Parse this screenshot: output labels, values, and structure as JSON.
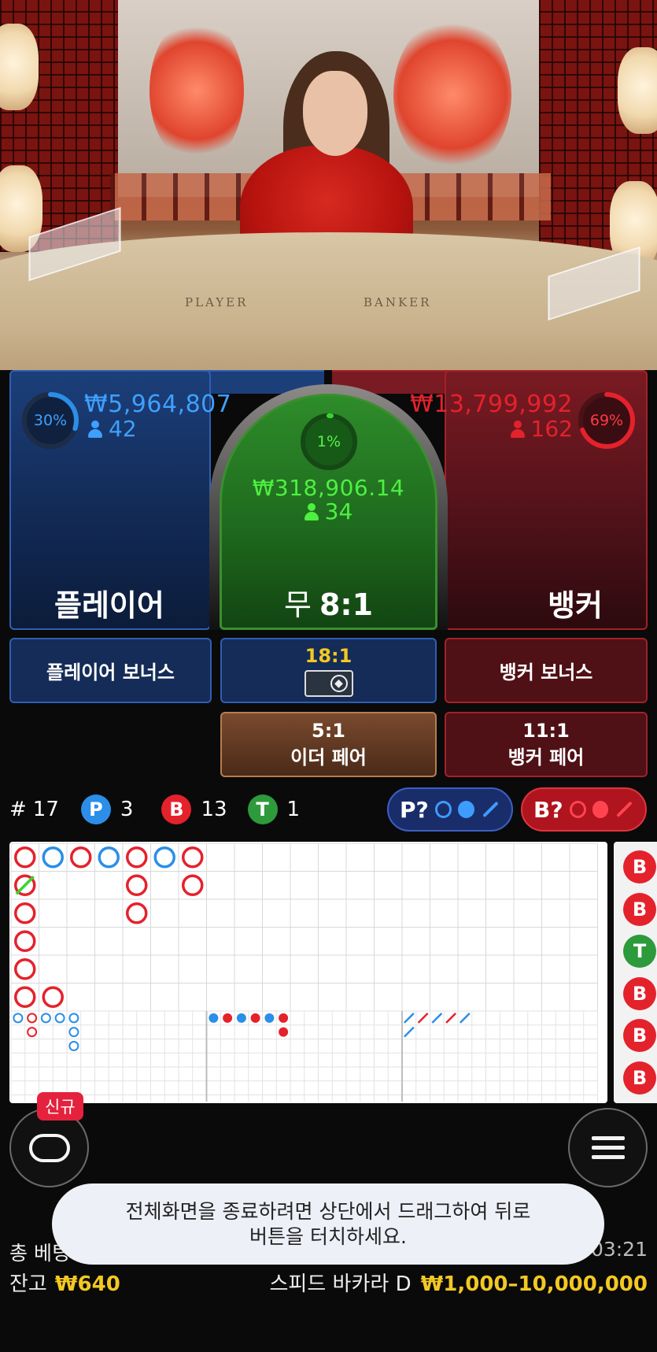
{
  "video": {
    "table_left_text": "PLAYER",
    "table_right_text": "BANKER"
  },
  "colors": {
    "player_blue": "#2b8ee8",
    "banker_red": "#e4222c",
    "tie_green": "#37d52f",
    "gold": "#f3c823"
  },
  "player": {
    "percent": "30%",
    "percent_value": 0.3,
    "amount": "₩5,964,807",
    "players": "42",
    "label": "플레이어"
  },
  "tie": {
    "percent": "1%",
    "percent_value": 0.01,
    "amount": "₩318,906.14",
    "players": "34",
    "label_main": "무",
    "label_odds": "8:1"
  },
  "banker": {
    "percent": "69%",
    "percent_value": 0.69,
    "amount": "₩13,799,992",
    "players": "162",
    "label": "뱅커"
  },
  "side_bets": {
    "player_bonus": "플레이어 보너스",
    "dragon_odds": "18:1",
    "banker_bonus": "뱅커 보너스",
    "either_pair_odds": "5:1",
    "either_pair_label": "이더 페어",
    "banker_pair_odds": "11:1",
    "banker_pair_label": "뱅커 페어"
  },
  "stats": {
    "round_prefix": "#",
    "round": "17",
    "p_letter": "P",
    "p_count": "3",
    "b_letter": "B",
    "b_count": "13",
    "t_letter": "T",
    "t_count": "1"
  },
  "predict": {
    "player": "P?",
    "banker": "B?"
  },
  "scoreboard": {
    "big_road": [
      {
        "col": 0,
        "row": 0,
        "r": "B"
      },
      {
        "col": 0,
        "row": 1,
        "r": "B",
        "tie": true
      },
      {
        "col": 0,
        "row": 2,
        "r": "B"
      },
      {
        "col": 0,
        "row": 3,
        "r": "B"
      },
      {
        "col": 0,
        "row": 4,
        "r": "B"
      },
      {
        "col": 0,
        "row": 5,
        "r": "B"
      },
      {
        "col": 1,
        "row": 0,
        "r": "P"
      },
      {
        "col": 1,
        "row": 5,
        "r": "B"
      },
      {
        "col": 2,
        "row": 0,
        "r": "B"
      },
      {
        "col": 3,
        "row": 0,
        "r": "P"
      },
      {
        "col": 4,
        "row": 0,
        "r": "B"
      },
      {
        "col": 4,
        "row": 1,
        "r": "B"
      },
      {
        "col": 4,
        "row": 2,
        "r": "B"
      },
      {
        "col": 5,
        "row": 0,
        "r": "P"
      },
      {
        "col": 6,
        "row": 0,
        "r": "B"
      },
      {
        "col": 6,
        "row": 1,
        "r": "B"
      }
    ],
    "big_eye": [
      {
        "col": 0,
        "row": 0,
        "c": "P"
      },
      {
        "col": 1,
        "row": 0,
        "c": "B"
      },
      {
        "col": 1,
        "row": 1,
        "c": "B"
      },
      {
        "col": 2,
        "row": 0,
        "c": "P"
      },
      {
        "col": 3,
        "row": 0,
        "c": "P"
      },
      {
        "col": 4,
        "row": 0,
        "c": "P"
      },
      {
        "col": 4,
        "row": 1,
        "c": "P"
      },
      {
        "col": 4,
        "row": 2,
        "c": "P"
      }
    ],
    "small_road": [
      {
        "col": 0,
        "row": 0,
        "c": "P"
      },
      {
        "col": 1,
        "row": 0,
        "c": "B"
      },
      {
        "col": 2,
        "row": 0,
        "c": "P"
      },
      {
        "col": 3,
        "row": 0,
        "c": "B"
      },
      {
        "col": 4,
        "row": 0,
        "c": "P"
      },
      {
        "col": 5,
        "row": 0,
        "c": "B"
      },
      {
        "col": 5,
        "row": 1,
        "c": "B"
      }
    ],
    "cockroach": [
      {
        "col": 0,
        "row": 0,
        "c": "P"
      },
      {
        "col": 0,
        "row": 1,
        "c": "P"
      },
      {
        "col": 1,
        "row": 0,
        "c": "B"
      },
      {
        "col": 2,
        "row": 0,
        "c": "P"
      },
      {
        "col": 3,
        "row": 0,
        "c": "B"
      },
      {
        "col": 4,
        "row": 0,
        "c": "P"
      }
    ],
    "side_column": [
      "B",
      "B",
      "T",
      "B",
      "B",
      "B"
    ]
  },
  "controls": {
    "new_badge": "신규"
  },
  "toast": {
    "line1": "전체화면을 종료하려면 상단에서 드래그하여 뒤로",
    "line2": "버튼을 터치하세요."
  },
  "footer": {
    "total_bet_label": "총 베팅",
    "time": "/:03:21",
    "balance_label": "잔고",
    "balance_value": "₩640",
    "table_name": "스피드 바카라 D",
    "limits": "₩1,000–10,000,000"
  }
}
